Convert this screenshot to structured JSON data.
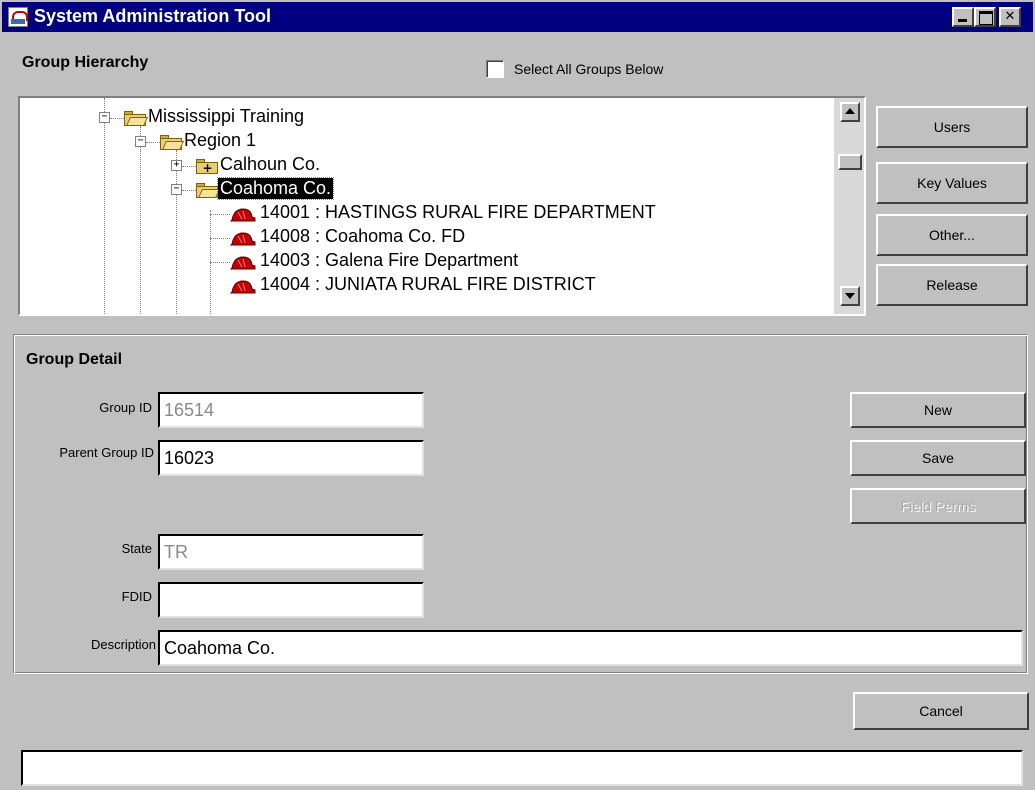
{
  "window": {
    "title": "System Administration Tool"
  },
  "hierarchy": {
    "heading": "Group Hierarchy",
    "select_all_label": "Select All Groups Below",
    "tree": {
      "root": "Mississippi Training",
      "region": "Region 1",
      "county_collapsed": "Calhoun Co.",
      "county_selected": "Coahoma Co.",
      "departments": [
        "14001 : HASTINGS RURAL FIRE DEPARTMENT",
        "14008 : Coahoma Co. FD",
        "14003 : Galena Fire Department",
        "14004 : JUNIATA RURAL FIRE DISTRICT"
      ]
    },
    "buttons": {
      "users": "Users",
      "key_values": "Key Values",
      "other": "Other...",
      "release": "Release"
    }
  },
  "detail": {
    "heading": "Group Detail",
    "fields": {
      "group_id_label": "Group ID",
      "group_id_value": "16514",
      "parent_group_id_label": "Parent Group ID",
      "parent_group_id_value": "16023",
      "state_label": "State",
      "state_value": "TR",
      "fdid_label": "FDID",
      "fdid_value": "",
      "description_label": "Description",
      "description_value": "Coahoma Co."
    },
    "buttons": {
      "new": "New",
      "save": "Save",
      "field_perms": "Field Perms"
    }
  },
  "footer": {
    "cancel": "Cancel",
    "status_text": ""
  }
}
